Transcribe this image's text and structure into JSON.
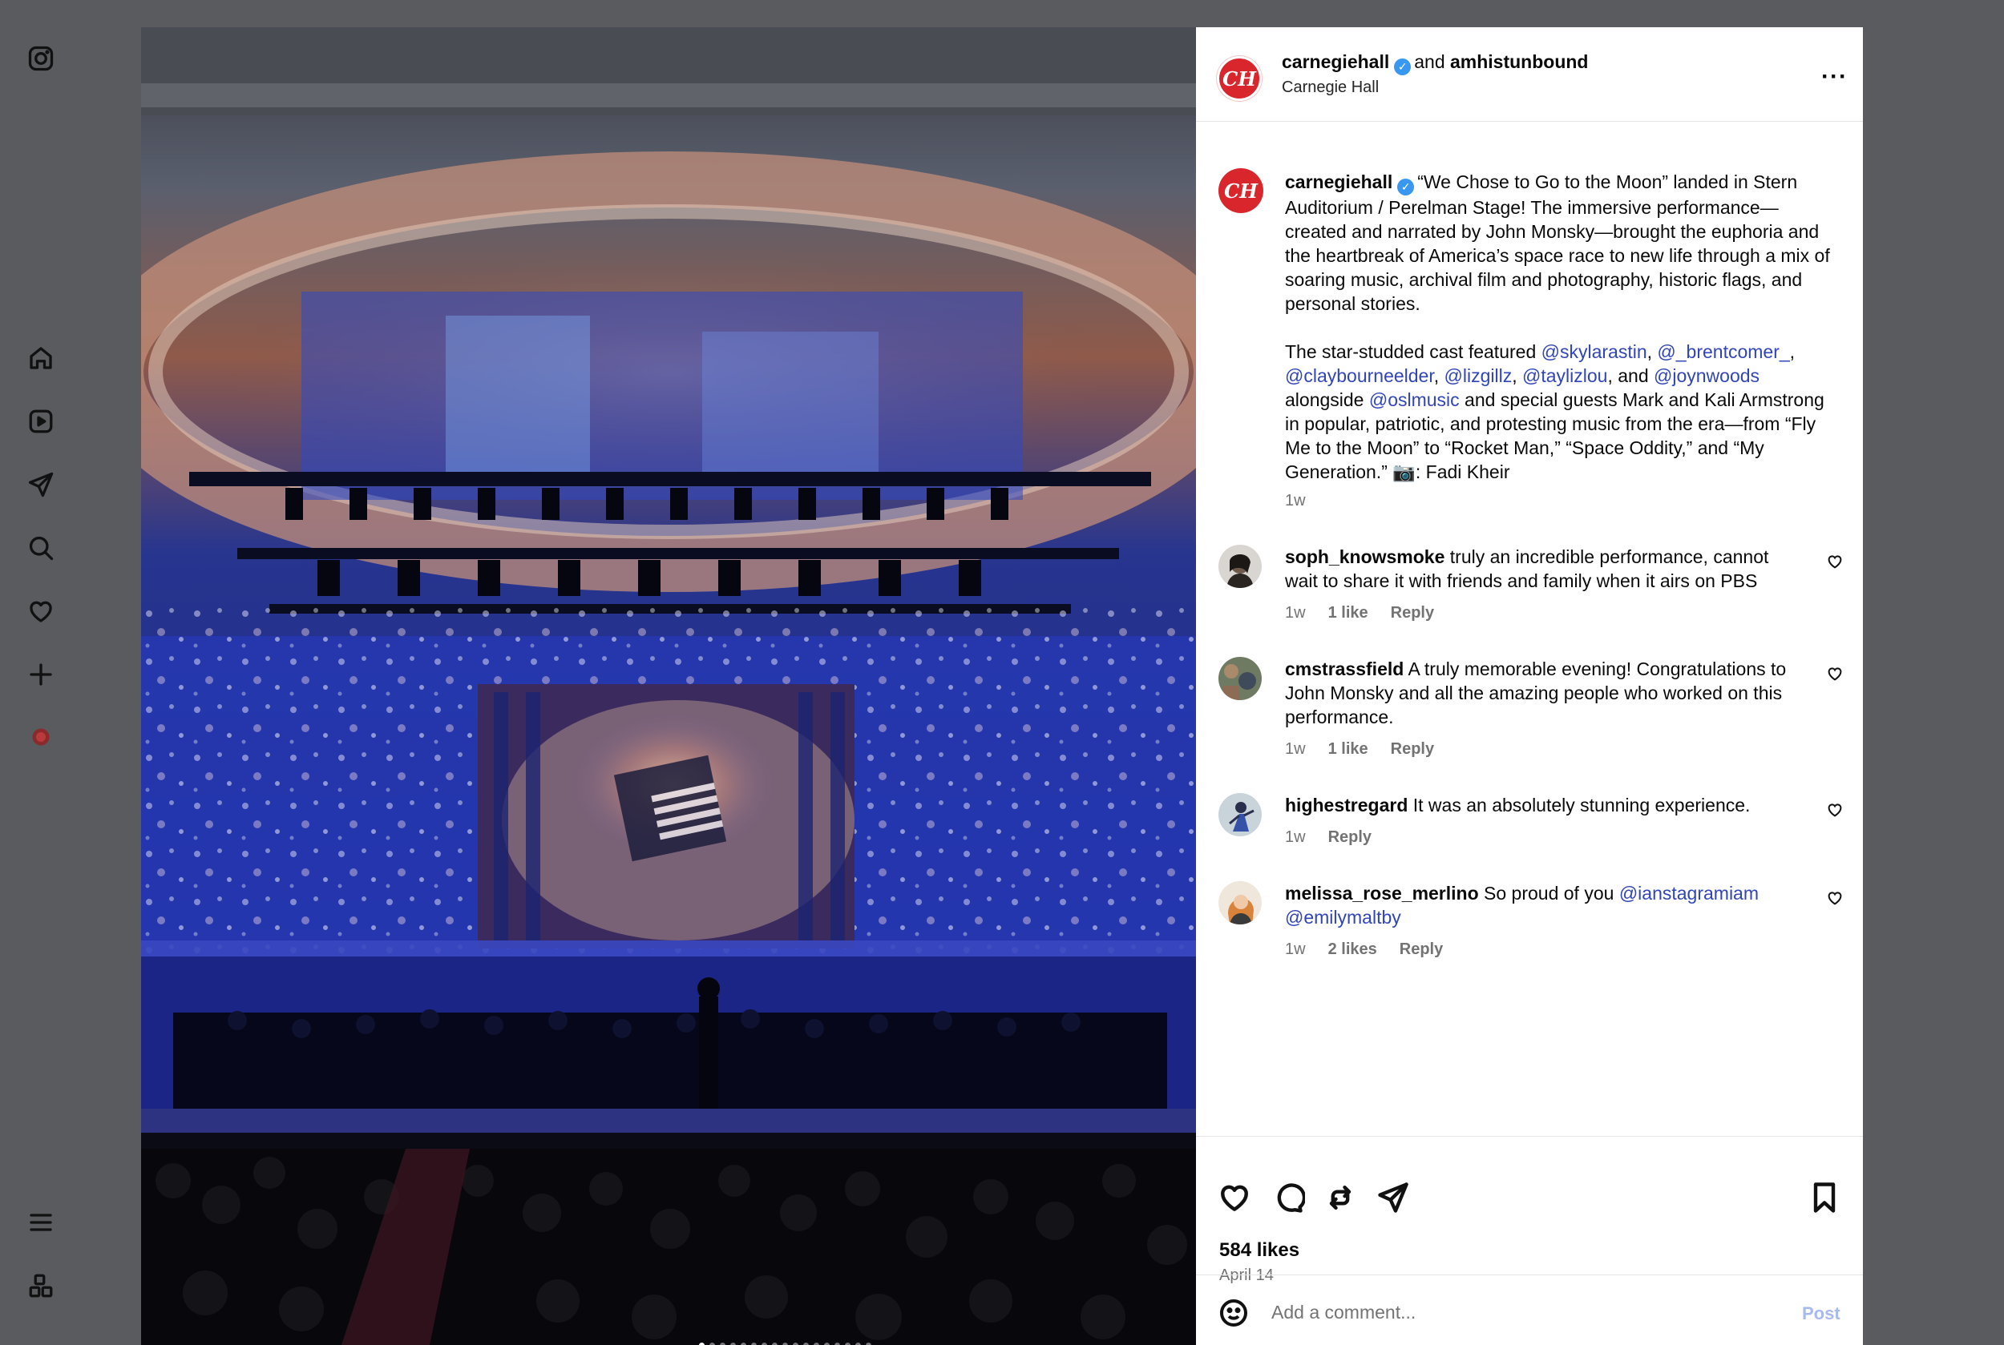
{
  "sidebar": {
    "icons": [
      "instagram-icon",
      "home-icon",
      "reels-icon",
      "messages-icon",
      "search-icon",
      "notifications-icon",
      "create-icon",
      "profile-icon",
      "menu-icon",
      "more-apps-icon"
    ]
  },
  "carousel": {
    "slide_count": 17,
    "active_index": 0
  },
  "header": {
    "account": "carnegiehall",
    "joiner": "and",
    "collaborator": "amhistunbound",
    "location": "Carnegie Hall",
    "avatar_text": "CH"
  },
  "caption": {
    "username": "carnegiehall",
    "paragraph1": "“We Chose to Go to the Moon” landed in Stern Auditorium / Perelman Stage! The immersive performance—created and narrated by John Monsky—brought the euphoria and the heartbreak of America’s space race to new life through a mix of soaring music, archival film and photography, historic flags, and personal stories.",
    "p2_a": "The star-studded cast featured ",
    "m1": "@skylarastin",
    "sep1": ", ",
    "m2": "@_brentcomer_",
    "sep2": ", ",
    "m3": "@claybourneelder",
    "sep3": ", ",
    "m4": "@lizgillz",
    "sep4": ", ",
    "m5": "@taylizlou",
    "sep5": ", and ",
    "m6": "@joynwoods",
    "sep6": " alongside ",
    "m7": "@oslmusic",
    "p2_b": " and special guests Mark and Kali Armstrong in popular, patriotic, and protesting music from the era—from “Fly Me to the Moon” to “Rocket Man,” “Space Oddity,” and “My Generation.” 📷: Fadi Kheir",
    "time": "1w"
  },
  "comments": [
    {
      "username": "soph_knowsmoke",
      "text": "truly an incredible performance, cannot wait to share it with friends and family when it airs on PBS",
      "time": "1w",
      "likes": "1 like",
      "reply": "Reply"
    },
    {
      "username": "cmstrassfield",
      "text": "A truly memorable evening! Congratulations to John Monsky and all the amazing people who worked on this performance.",
      "time": "1w",
      "likes": "1 like",
      "reply": "Reply"
    },
    {
      "username": "highestregard",
      "text": "It was an absolutely stunning experience.",
      "time": "1w",
      "likes": "",
      "reply": "Reply"
    },
    {
      "username": "melissa_rose_merlino",
      "text": "So proud of you ",
      "mention1": "@ianstagramiam",
      "mention2": "@emilymaltby",
      "time": "1w",
      "likes": "2 likes",
      "reply": "Reply"
    }
  ],
  "actions": {
    "likes": "584 likes",
    "date": "April 14"
  },
  "add_comment": {
    "placeholder": "Add a comment...",
    "post_label": "Post"
  }
}
